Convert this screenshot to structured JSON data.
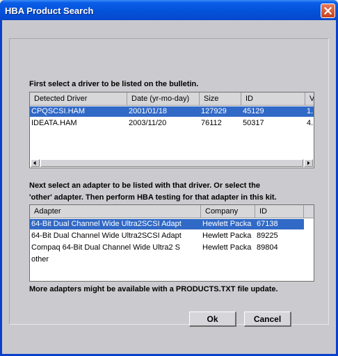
{
  "window": {
    "title": "HBA Product Search"
  },
  "drivers": {
    "instruction": "First select a driver to be listed on the bulletin.",
    "columns": [
      "Detected Driver",
      "Date (yr-mo-day)",
      "Size",
      "ID",
      "V"
    ],
    "rows": [
      [
        "CPQSCSI.HAM",
        "2001/01/18",
        "127929",
        "45129",
        "1."
      ],
      [
        "IDEATA.HAM",
        "2003/11/20",
        "76112",
        "50317",
        "4."
      ]
    ],
    "selected_index": 0
  },
  "adapters": {
    "instruction_line1": "Next select an adapter to be listed with that driver.  Or select the",
    "instruction_line2": "'other' adapter.  Then perform HBA testing for that adapter in this kit.",
    "columns": [
      "Adapter",
      "Company",
      "ID"
    ],
    "rows": [
      [
        "64-Bit Dual Channel Wide Ultra2SCSI Adapt",
        "Hewlett Packa",
        "67138"
      ],
      [
        "64-Bit Dual Channel Wide Ultra2SCSI Adapt",
        "Hewlett Packa",
        "89225"
      ],
      [
        "Compaq 64-Bit Dual Channel Wide Ultra2 S",
        "Hewlett Packa",
        "89804"
      ],
      [
        "other",
        "",
        ""
      ]
    ],
    "selected_index": 0
  },
  "note": "More adapters might be available with a PRODUCTS.TXT file update.",
  "buttons": {
    "ok": "Ok",
    "cancel": "Cancel"
  },
  "icons": {
    "close": "close-icon",
    "scroll_left": "arrow-left-icon",
    "scroll_right": "arrow-right-icon"
  }
}
